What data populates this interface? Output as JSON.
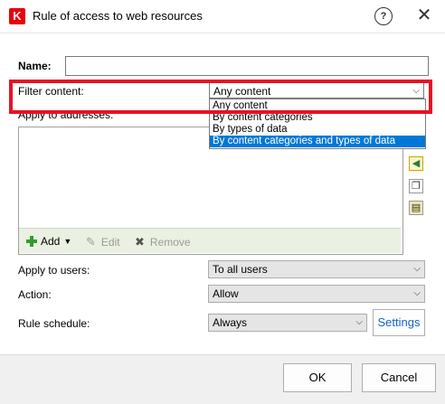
{
  "window": {
    "title": "Rule of access to web resources",
    "app_icon_letter": "K",
    "help_glyph": "?",
    "close_glyph": "✕"
  },
  "form": {
    "name_label": "Name:",
    "name_value": "",
    "filter_label": "Filter content:",
    "filter_value": "Any content",
    "filter_options": [
      "Any content",
      "By content categories",
      "By types of data",
      "By content categories and types of data"
    ],
    "filter_highlighted_option": "By content categories and types of data",
    "addresses_label": "Apply to addresses:",
    "users_label": "Apply to users:",
    "users_value": "To all users",
    "action_label": "Action:",
    "action_value": "Allow",
    "schedule_label": "Rule schedule:",
    "schedule_value": "Always",
    "settings_label": "Settings"
  },
  "toolbar": {
    "add_label": "Add",
    "edit_label": "Edit",
    "remove_label": "Remove"
  },
  "footer": {
    "ok_label": "OK",
    "cancel_label": "Cancel"
  },
  "colors": {
    "highlight_border": "#e81123",
    "selection": "#0078d7",
    "toolbar_bg": "#eaf1e2",
    "brand_red": "#e8000d"
  }
}
